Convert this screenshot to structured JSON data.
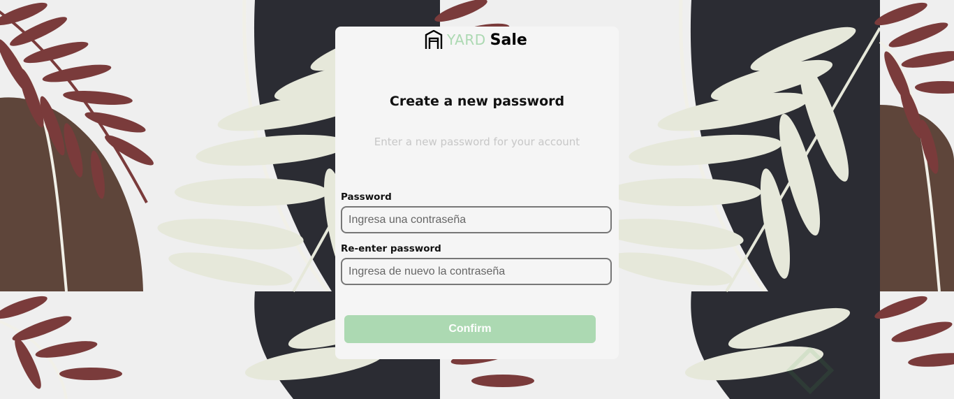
{
  "logo": {
    "part1": "YARD",
    "part2": "Sale",
    "icon": "garage-icon"
  },
  "title": "Create a new password",
  "subtitle": "Enter a new password for your account",
  "password": {
    "label": "Password",
    "placeholder": "Ingresa una contraseña"
  },
  "repassword": {
    "label": "Re-enter password",
    "placeholder": "Ingresa de nuevo la contraseña"
  },
  "confirm_label": "Confirm",
  "colors": {
    "accent": "#acd9b2",
    "background": "#efefef",
    "card": "#f5f5f5",
    "leaf_red": "#7a3b3b",
    "arch_brown": "#5e453a",
    "arch_dark": "#2b2c33",
    "leaf_cream": "#e6e8da"
  }
}
